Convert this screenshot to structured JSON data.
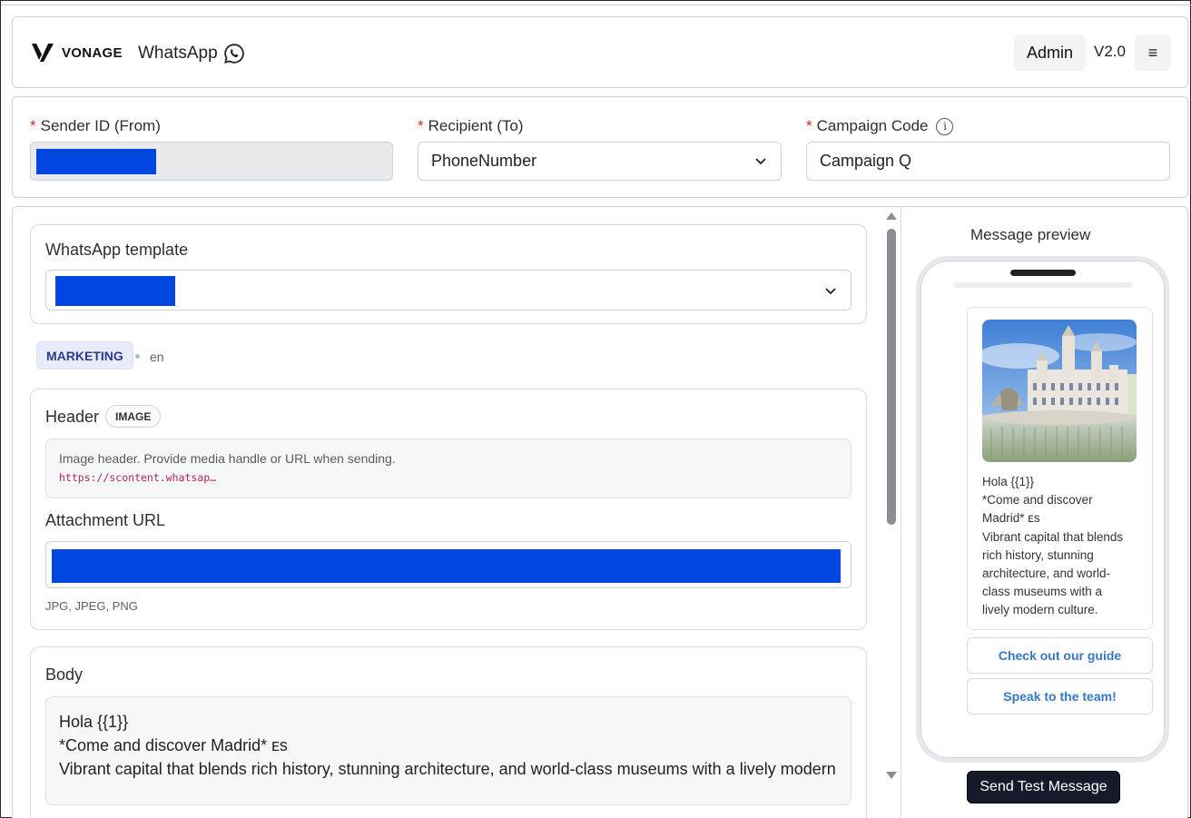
{
  "header": {
    "brand": "VONAGE",
    "app_name": "WhatsApp",
    "admin_label": "Admin",
    "version": "V2.0",
    "menu_glyph": "≡"
  },
  "fields": {
    "sender": {
      "label": "Sender ID (From)",
      "required_mark": "*"
    },
    "recipient": {
      "label": "Recipient (To)",
      "required_mark": "*",
      "value": "PhoneNumber"
    },
    "campaign": {
      "label": "Campaign Code",
      "required_mark": "*",
      "value": "Campaign Q",
      "info_glyph": "i"
    }
  },
  "template": {
    "label": "WhatsApp template",
    "category": "MARKETING",
    "language": "en"
  },
  "header_section": {
    "label": "Header",
    "type_badge": "IMAGE",
    "hint": "Image header. Provide media handle or URL when sending.",
    "hint_url": "https://scontent.whatsap…",
    "attachment_label": "Attachment URL",
    "formats": "JPG, JPEG, PNG"
  },
  "body_section": {
    "label": "Body",
    "lines": [
      "Hola {{1}}",
      "*Come and discover Madrid* ᴇs",
      "Vibrant capital that blends rich history, stunning architecture, and world-class museums with a lively modern"
    ]
  },
  "preview": {
    "title": "Message preview",
    "text_lines": [
      "Hola {{1}}",
      "*Come and discover",
      "Madrid* ᴇs",
      "Vibrant capital that blends",
      "rich history, stunning",
      "architecture, and world-",
      "class museums with a",
      "lively modern culture."
    ],
    "buttons": [
      "Check out our guide",
      "Speak to the team!"
    ],
    "send_label": "Send Test Message"
  },
  "colors": {
    "redaction": "#0047e1",
    "cta_text": "#3577c9",
    "send_button": "#161a2b",
    "badge_bg": "#e6ecfb"
  }
}
